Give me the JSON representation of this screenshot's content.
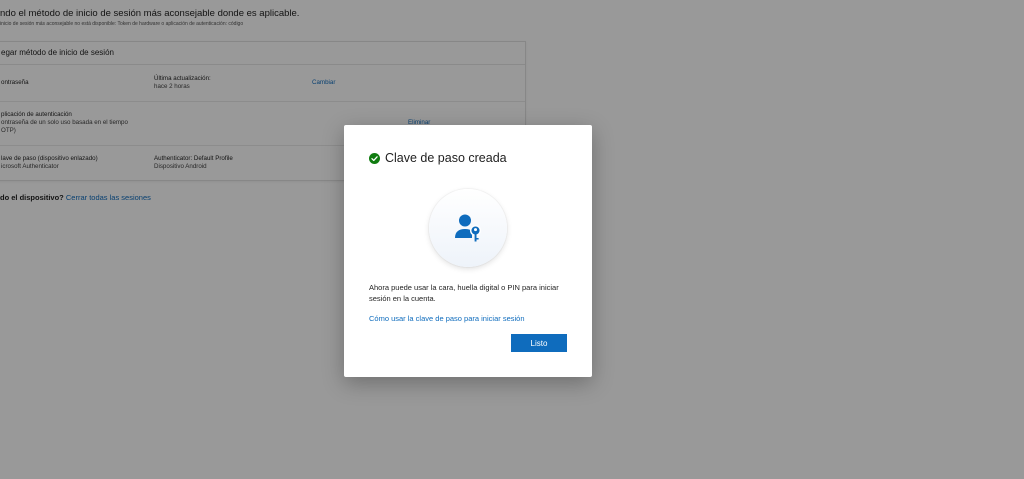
{
  "page": {
    "heading": "ndo el método de inicio de sesión más aconsejable donde es aplicable.",
    "subheading": "inicio de sesión más aconsejable no está disponible: Token de hardware o aplicación de autenticación: código"
  },
  "methods_card": {
    "add_method_label": "egar método de inicio de sesión",
    "rows": [
      {
        "name": "ontraseña",
        "detail_label": "Última actualización:",
        "detail_value": "hace 2 horas",
        "action": "Cambiar"
      },
      {
        "name": "plicación de autenticación",
        "name_sub1": "ontraseña de un solo uso basada en el tiempo",
        "name_sub2": "OTP)",
        "action": "Eliminar"
      },
      {
        "name": "lave de paso (dispositivo enlazado)",
        "name_sub1": "icrosoft Authenticator",
        "detail_label": "Authenticator: Default Profile",
        "detail_value": "Dispositivo Android"
      }
    ]
  },
  "device_line": {
    "question": "do el dispositivo?",
    "link": "Cerrar todas las sesiones"
  },
  "dialog": {
    "title": "Clave de paso creada",
    "icon": "check-circle-icon",
    "hero_icon": "person-key-icon",
    "body": "Ahora puede usar la cara, huella digital o PIN para iniciar sesión en la cuenta.",
    "help_link": "Cómo usar la clave de paso para iniciar sesión",
    "done_button": "Listo"
  },
  "colors": {
    "accent": "#0f6cbd",
    "success": "#107c10",
    "overlay": "rgba(0,0,0,0.40)"
  }
}
